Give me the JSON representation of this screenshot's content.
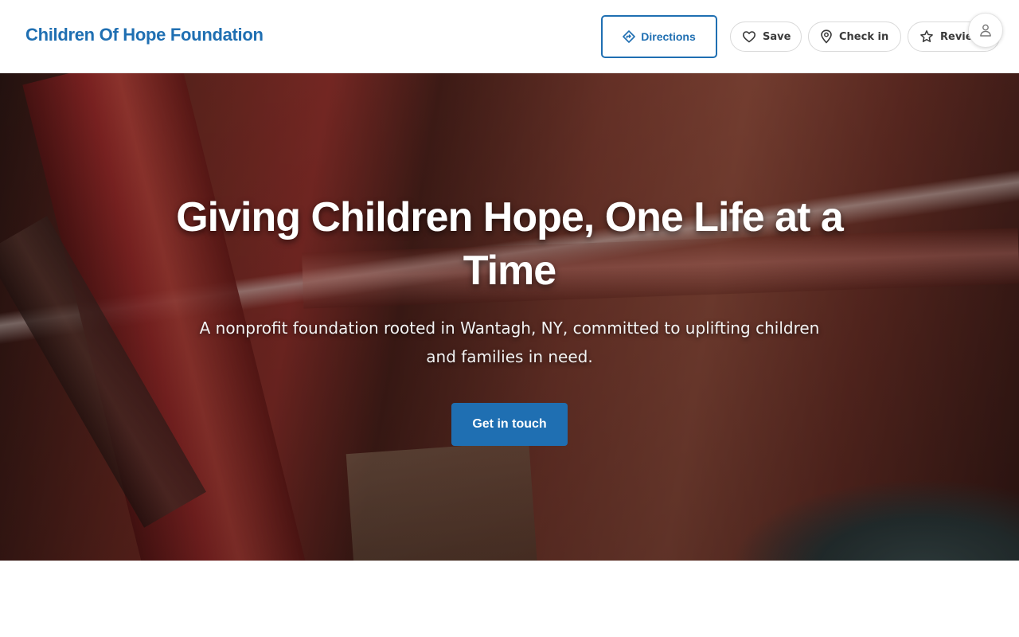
{
  "header": {
    "brand": "Children Of Hope Foundation",
    "actions": {
      "directions": "Directions",
      "save": "Save",
      "check_in": "Check in",
      "review": "Review"
    }
  },
  "hero": {
    "title": "Giving Children Hope, One Life at a Time",
    "subtitle": "A nonprofit foundation rooted in Wantagh, NY, committed to uplifting children and families in need.",
    "cta": "Get in touch"
  },
  "icons": {
    "directions": "directions-icon",
    "save": "heart-icon",
    "check_in": "location-pin-icon",
    "review": "star-icon",
    "account": "user-icon"
  },
  "colors": {
    "brand": "#1f6fb2",
    "cta_background": "#1f6fb2",
    "hero_text": "#ffffff"
  }
}
